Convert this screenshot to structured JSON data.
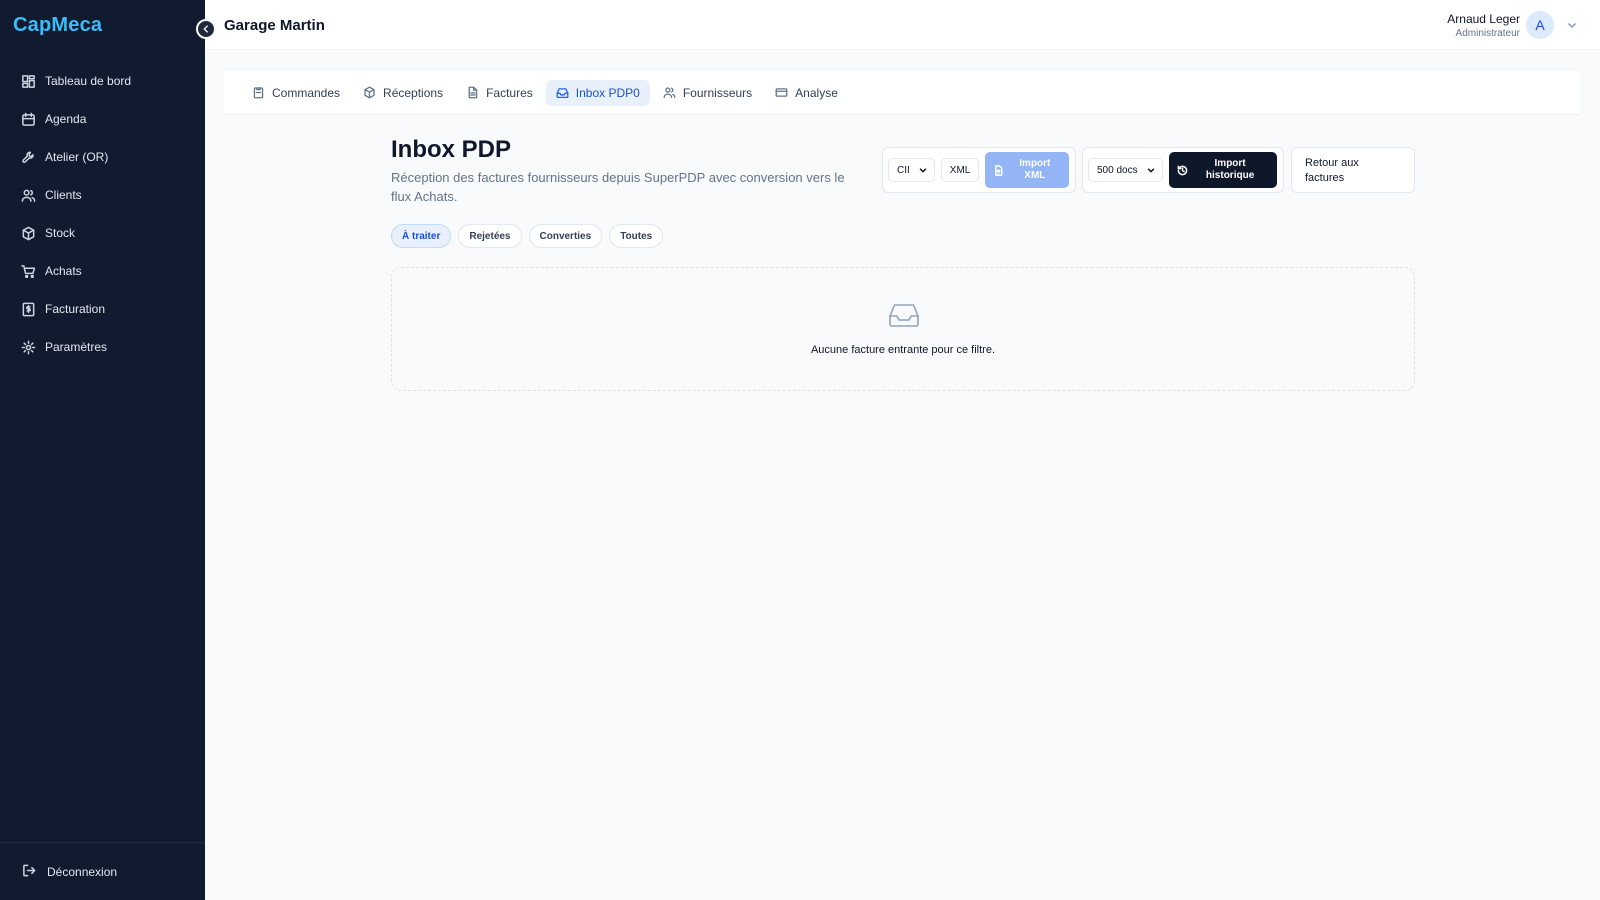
{
  "sidebar": {
    "brand": "CapMeca",
    "items": [
      {
        "label": "Tableau de bord",
        "icon": "dashboard-icon"
      },
      {
        "label": "Agenda",
        "icon": "calendar-icon"
      },
      {
        "label": "Atelier (OR)",
        "icon": "wrench-icon"
      },
      {
        "label": "Clients",
        "icon": "users-icon"
      },
      {
        "label": "Stock",
        "icon": "box-icon"
      },
      {
        "label": "Achats",
        "icon": "cart-icon"
      },
      {
        "label": "Facturation",
        "icon": "invoice-icon"
      },
      {
        "label": "Paramètres",
        "icon": "gear-icon"
      }
    ],
    "logout": "Déconnexion"
  },
  "header": {
    "org_name": "Garage Martin",
    "user_name": "Arnaud Leger",
    "user_role": "Administrateur",
    "avatar_initial": "A"
  },
  "tabs": [
    {
      "label": "Commandes",
      "icon": "clipboard-icon",
      "active": false
    },
    {
      "label": "Réceptions",
      "icon": "package-icon",
      "active": false
    },
    {
      "label": "Factures",
      "icon": "file-icon",
      "active": false
    },
    {
      "label": "Inbox PDP0",
      "icon": "inbox-icon",
      "active": true
    },
    {
      "label": "Fournisseurs",
      "icon": "users-icon",
      "active": false
    },
    {
      "label": "Analyse",
      "icon": "card-icon",
      "active": false
    }
  ],
  "page": {
    "title": "Inbox PDP",
    "description": "Réception des factures fournisseurs depuis SuperPDP avec conversion vers le flux Achats."
  },
  "toolbar": {
    "format_select": "CII",
    "xml_button": "XML",
    "import_xml_line1": "Import",
    "import_xml_line2": "XML",
    "docs_select": "500 docs",
    "import_history_line1": "Import",
    "import_history_line2": "historique",
    "back_line1": "Retour aux",
    "back_line2": "factures"
  },
  "filters": [
    {
      "label": "À traiter",
      "active": true
    },
    {
      "label": "Rejetées",
      "active": false
    },
    {
      "label": "Converties",
      "active": false
    },
    {
      "label": "Toutes",
      "active": false
    }
  ],
  "empty_state": {
    "icon": "inbox-icon",
    "message": "Aucune facture entrante pour ce filtre."
  },
  "colors": {
    "sidebar_bg": "#111a2e",
    "brand": "#38bdf8",
    "accent": "#1d4ed8",
    "dark_button": "#0f172a",
    "disabled_primary": "#93b4f5"
  }
}
